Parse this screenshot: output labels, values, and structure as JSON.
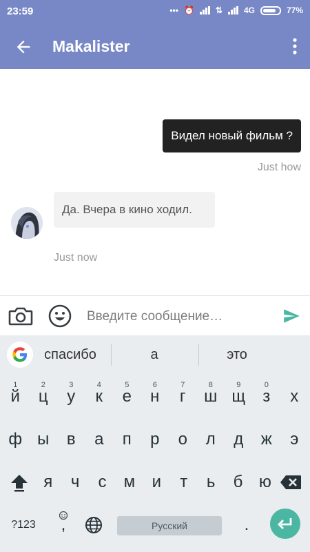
{
  "status_bar": {
    "time": "23:59",
    "network": "4G",
    "battery_text": "77%",
    "battery_level": 0.77
  },
  "app_bar": {
    "title": "Makalister",
    "back_icon": "arrow-left-icon",
    "menu_icon": "more-vert-icon"
  },
  "messages": [
    {
      "direction": "out",
      "text": "Видел новый фильм ?",
      "time": "Just how"
    },
    {
      "direction": "in",
      "text": "Да. Вчера в кино ходил.",
      "time": "Just now",
      "avatar_icon": "avatar-image"
    }
  ],
  "composer": {
    "placeholder": "Введите сообщение…",
    "camera_icon": "camera-icon",
    "emoji_icon": "emoji-icon",
    "send_icon": "send-icon"
  },
  "keyboard": {
    "suggestions": [
      "спасибо",
      "а",
      "это"
    ],
    "row1": [
      {
        "k": "й",
        "n": "1"
      },
      {
        "k": "ц",
        "n": "2"
      },
      {
        "k": "у",
        "n": "3"
      },
      {
        "k": "к",
        "n": "4"
      },
      {
        "k": "е",
        "n": "5"
      },
      {
        "k": "н",
        "n": "6"
      },
      {
        "k": "г",
        "n": "7"
      },
      {
        "k": "ш",
        "n": "8"
      },
      {
        "k": "щ",
        "n": "9"
      },
      {
        "k": "з",
        "n": "0"
      },
      {
        "k": "х",
        "n": ""
      }
    ],
    "row2": [
      "ф",
      "ы",
      "в",
      "а",
      "п",
      "р",
      "о",
      "л",
      "д",
      "ж",
      "э"
    ],
    "row3": [
      "я",
      "ч",
      "с",
      "м",
      "и",
      "т",
      "ь",
      "б",
      "ю"
    ],
    "symbols_label": "?123",
    "comma": ",",
    "space_label": "Русский",
    "period": ".",
    "colors": {
      "accent": "#7888c6",
      "enter": "#4bb7a3",
      "send": "#4bb7a3"
    }
  }
}
